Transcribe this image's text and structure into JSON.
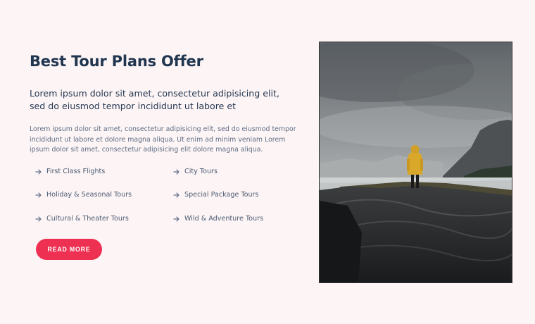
{
  "section": {
    "title": "Best Tour Plans Offer",
    "lead": "Lorem ipsum dolor sit amet, consectetur adipisicing elit, sed do eiusmod tempor incididunt ut labore et",
    "description": "Lorem ipsum dolor sit amet, consectetur adipisicing elit, sed do eiusmod tempor incididunt ut labore et dolore magna aliqua. Ut enim ad minim veniam Lorem ipsum dolor sit amet, consectetur adipisicing elit dolore magna aliqua.",
    "features": [
      {
        "label": "First Class Flights",
        "icon": "arrow-right-icon"
      },
      {
        "label": "City Tours",
        "icon": "arrow-right-icon"
      },
      {
        "label": "Holiday & Seasonal Tours",
        "icon": "arrow-right-icon"
      },
      {
        "label": "Special Package Tours",
        "icon": "arrow-right-icon"
      },
      {
        "label": "Cultural & Theater Tours",
        "icon": "arrow-right-icon"
      },
      {
        "label": "Wild & Adventure Tours",
        "icon": "arrow-right-icon"
      }
    ],
    "button_label": "READ MORE"
  },
  "colors": {
    "background": "#fdf5f5",
    "title": "#1f3550",
    "accent": "#ee3152",
    "text_muted": "#5f6d84"
  }
}
